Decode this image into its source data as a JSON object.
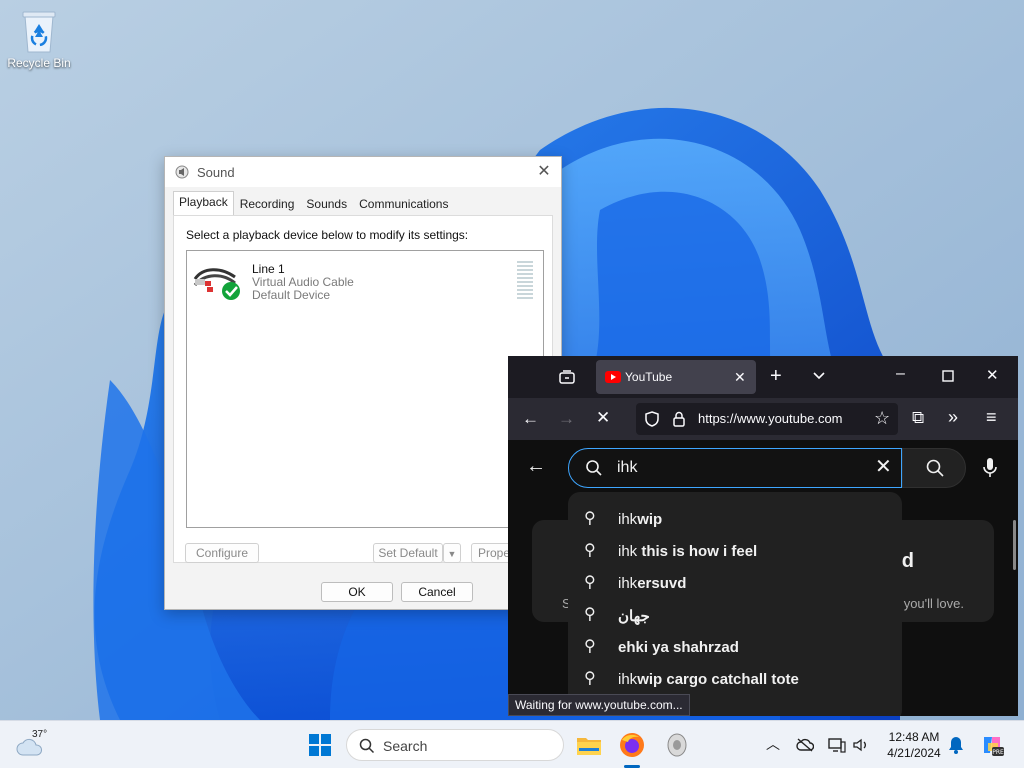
{
  "desktop": {
    "icons": [
      {
        "label": "Recycle Bin",
        "icon": "recycle-bin-icon"
      }
    ]
  },
  "sound_dialog": {
    "title": "Sound",
    "tabs": [
      "Playback",
      "Recording",
      "Sounds",
      "Communications"
    ],
    "active_tab": "Playback",
    "instruction": "Select a playback device below to modify its settings:",
    "device": {
      "name": "Line 1",
      "description": "Virtual Audio Cable",
      "status": "Default Device"
    },
    "buttons": {
      "configure": "Configure",
      "set_default": "Set Default",
      "properties": "Prope",
      "ok": "OK",
      "cancel": "Cancel"
    }
  },
  "browser": {
    "tab_title": "YouTube",
    "url": "https://www.youtube.com",
    "status": "Waiting for www.youtube.com...",
    "search_value": "ihk",
    "card_title_fragment": "d",
    "card_sub_left": "S",
    "card_sub_right": "you'll love.",
    "suggestions": [
      {
        "prefix": "ihk",
        "rest": "wip"
      },
      {
        "prefix": "ihk",
        "rest": " this is how i feel"
      },
      {
        "prefix": "ihk",
        "rest": "ersuvd"
      },
      {
        "prefix": "",
        "rest": "جهان"
      },
      {
        "prefix": "",
        "rest": "ehki ya shahrzad"
      },
      {
        "prefix": "ihk",
        "rest": "wip cargo catchall tote"
      }
    ]
  },
  "taskbar": {
    "weather_temp": "37°",
    "search_label": "Search",
    "time": "12:48 AM",
    "date": "4/21/2024"
  },
  "colors": {
    "accent": "#0067c0",
    "youtube_red": "#ff0000",
    "search_focus": "#3ea6ff"
  }
}
